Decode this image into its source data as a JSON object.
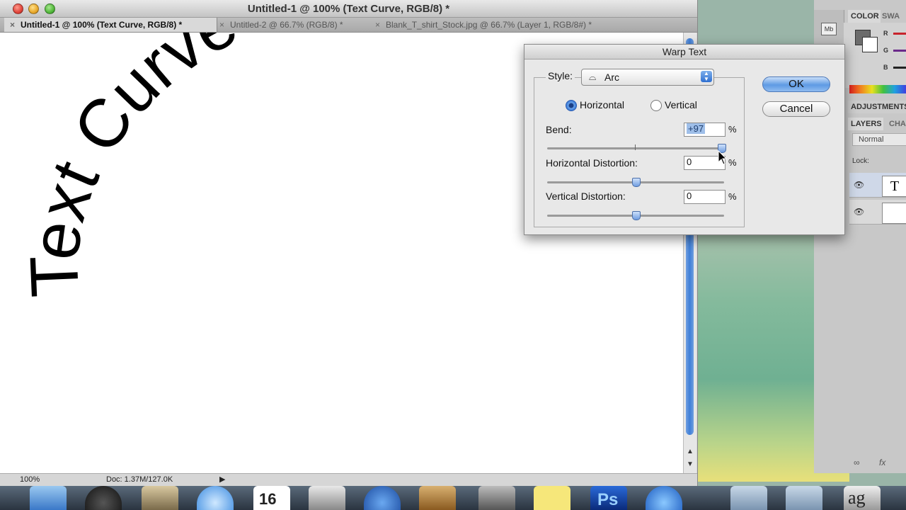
{
  "window": {
    "title": "Untitled-1 @ 100% (Text  Curve, RGB/8) *",
    "tabs": [
      {
        "label": "Untitled-1 @ 100% (Text  Curve, RGB/8) *",
        "active": true
      },
      {
        "label": "Untitled-2 @ 66.7% (RGB/8) *",
        "active": false
      },
      {
        "label": "Blank_T_shirt_Stock.jpg @ 66.7% (Layer 1, RGB/8#) *",
        "active": false
      }
    ],
    "close_glyph": "×"
  },
  "canvas": {
    "warped_text": "Text Curve"
  },
  "status": {
    "zoom": "100%",
    "doc_size": "Doc: 1.37M/127.0K"
  },
  "dialog": {
    "title": "Warp Text",
    "style_label": "Style:",
    "style_value": "Arc",
    "orientation": {
      "horizontal_label": "Horizontal",
      "vertical_label": "Vertical",
      "selected": "Horizontal"
    },
    "bend": {
      "label": "Bend:",
      "value": "+97",
      "unit": "%",
      "percent": 97
    },
    "horizontal_distortion": {
      "label": "Horizontal Distortion:",
      "value": "0",
      "unit": "%",
      "percent": 0
    },
    "vertical_distortion": {
      "label": "Vertical Distortion:",
      "value": "0",
      "unit": "%",
      "percent": 0
    },
    "ok_label": "OK",
    "cancel_label": "Cancel"
  },
  "panels": {
    "mini_bridge_label": "Mb",
    "color_tab": "COLOR",
    "swatches_tab": "SWA",
    "color_channels": [
      "R",
      "G",
      "B"
    ],
    "adjustments_tab": "ADJUSTMENTS",
    "layers_tab": "LAYERS",
    "channels_tab": "CHA",
    "blend_mode": "Normal",
    "lock_label": "Lock:",
    "text_layer_thumb": "T"
  },
  "dock": {
    "calendar_month": "JUL",
    "calendar_day": "16",
    "photoshop_label": "Ps",
    "font_app_glyph": "ag"
  },
  "colors": {
    "accent_blue": "#3e7fd8",
    "selection_highlight": "#9fbfe9"
  }
}
